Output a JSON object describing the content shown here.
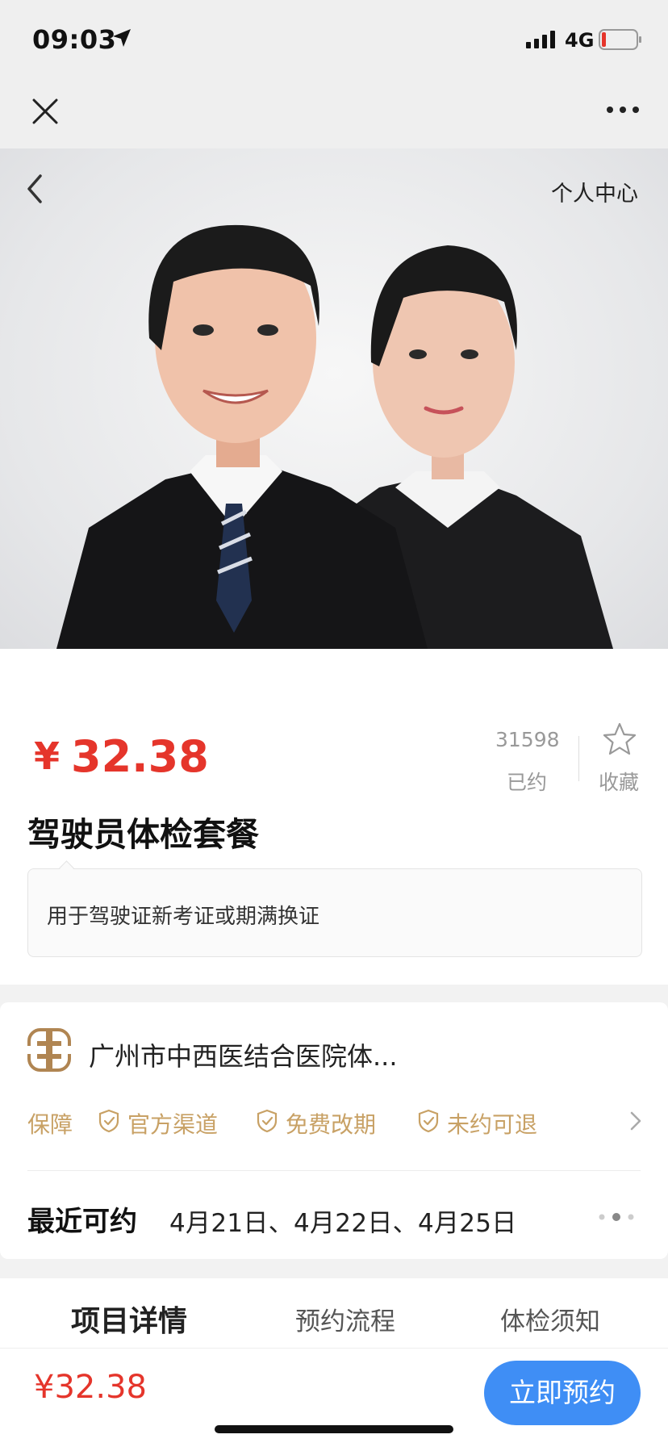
{
  "status_bar": {
    "time": "09:03",
    "network": "4G"
  },
  "nav": {
    "personal_center": "个人中心"
  },
  "product": {
    "price_symbol": "¥",
    "price": "32.38",
    "booked_count": "31598",
    "booked_label": "已约",
    "favorite_label": "收藏",
    "title": "驾驶员体检套餐",
    "description": "用于驾驶证新考证或期满换证"
  },
  "hospital": {
    "name": "广州市中西医结合医院体...",
    "guarantee_label": "保障",
    "guarantees": [
      "官方渠道",
      "免费改期",
      "未约可退"
    ]
  },
  "availability": {
    "label": "最近可约",
    "dates": "4月21日、4月22日、4月25日"
  },
  "tabs": [
    "项目详情",
    "预约流程",
    "体检须知"
  ],
  "bottom_bar": {
    "price": "¥32.38",
    "book_button": "立即预约"
  },
  "colors": {
    "price_red": "#e5352b",
    "gold": "#c8a165",
    "button_blue": "#3f8ef5"
  }
}
